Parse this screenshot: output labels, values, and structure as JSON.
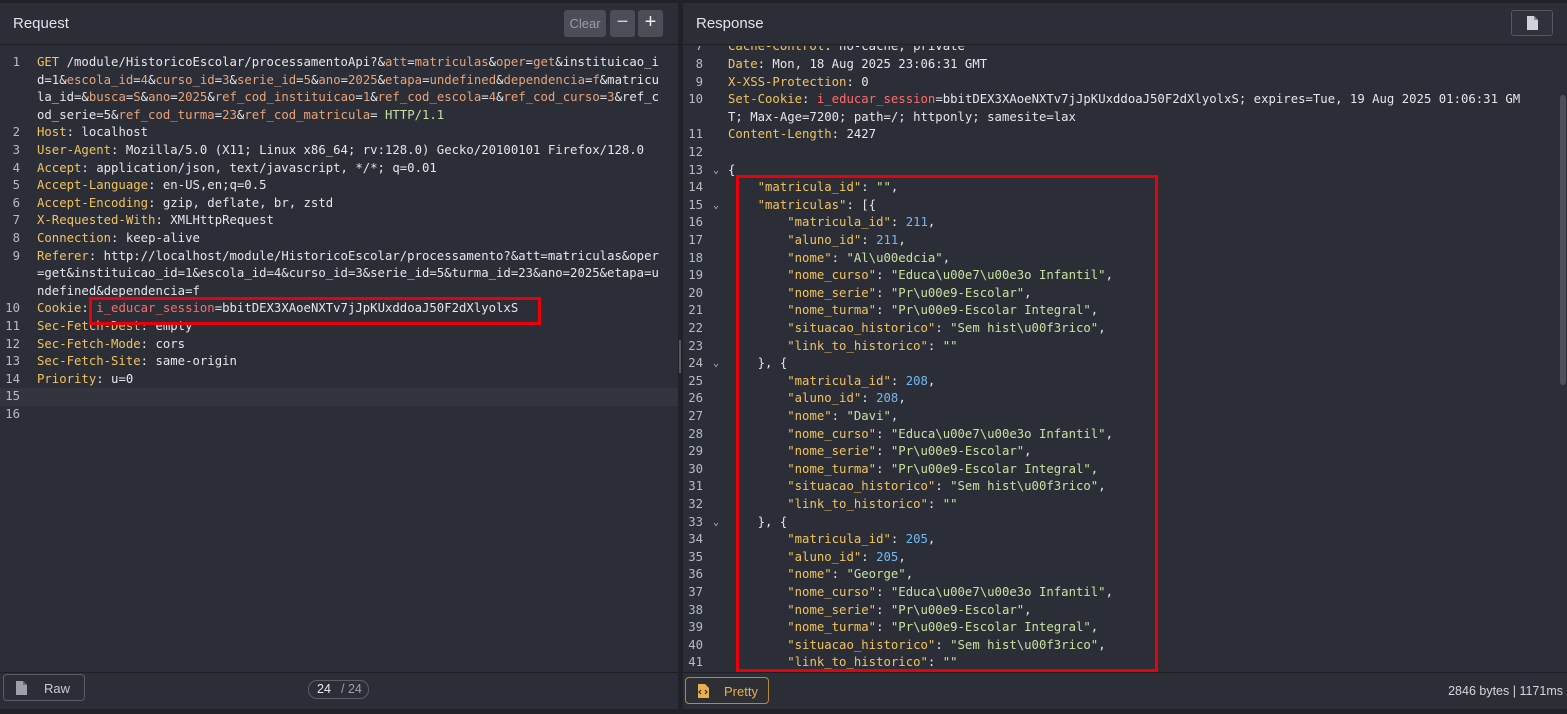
{
  "request": {
    "title": "Request",
    "clear_label": "Clear",
    "minus_label": "−",
    "plus_label": "+",
    "raw_label": "Raw",
    "pager_current": "24",
    "pager_total": "/ 24",
    "lines": [
      "GET /module/HistoricoEscolar/processamentoApi?&att=matriculas&oper=get&instituicao_i",
      "d=1&escola_id=4&curso_id=3&serie_id=5&ano=2025&etapa=undefined&dependencia=f&matricu",
      "la_id=&busca=S&ano=2025&ref_cod_instituicao=1&ref_cod_escola=4&ref_cod_curso=3&ref_c",
      "od_serie=5&ref_cod_turma=23&ref_cod_matricula= HTTP/1.1",
      "Host: localhost",
      "User-Agent: Mozilla/5.0 (X11; Linux x86_64; rv:128.0) Gecko/20100101 Firefox/128.0",
      "Accept: application/json, text/javascript, */*; q=0.01",
      "Accept-Language: en-US,en;q=0.5",
      "Accept-Encoding: gzip, deflate, br, zstd",
      "X-Requested-With: XMLHttpRequest",
      "Connection: keep-alive",
      "Referer: http://localhost/module/HistoricoEscolar/processamento?&att=matriculas&oper",
      "=get&instituicao_id=1&escola_id=4&curso_id=3&serie_id=5&turma_id=23&ano=2025&etapa=u",
      "ndefined&dependencia=f",
      "Cookie: i_educar_session=bbitDEX3XAoeNXTv7jJpKUxddoaJ50F2dXlyolxS",
      "Sec-Fetch-Dest: empty",
      "Sec-Fetch-Mode: cors",
      "Sec-Fetch-Site: same-origin",
      "Priority: u=0",
      "",
      ""
    ],
    "line_numbers": [
      "1",
      "",
      "",
      "",
      "2",
      "3",
      "4",
      "5",
      "6",
      "7",
      "8",
      "9",
      "",
      "",
      "10",
      "11",
      "12",
      "13",
      "14",
      "15",
      "16"
    ]
  },
  "response": {
    "title": "Response",
    "pretty_label": "Pretty",
    "stats": "2846 bytes  |  1171ms",
    "top_partial": "Cache-Control: no-cache, private",
    "lines": [
      "Date: Mon, 18 Aug 2025 23:06:31 GMT",
      "X-XSS-Protection: 0",
      "Set-Cookie: i_educar_session=bbitDEX3XAoeNXTv7jJpKUxddoaJ50F2dXlyolxS; expires=Tue, 19 Aug 2025 01:06:31 GM",
      "T; Max-Age=7200; path=/; httponly; samesite=lax",
      "Content-Length: 2427",
      "",
      "{",
      "    \"matricula_id\": \"\",",
      "    \"matriculas\": [{",
      "        \"matricula_id\": 211,",
      "        \"aluno_id\": 211,",
      "        \"nome\": \"Al\\u00edcia\",",
      "        \"nome_curso\": \"Educa\\u00e7\\u00e3o Infantil\",",
      "        \"nome_serie\": \"Pr\\u00e9-Escolar\",",
      "        \"nome_turma\": \"Pr\\u00e9-Escolar Integral\",",
      "        \"situacao_historico\": \"Sem hist\\u00f3rico\",",
      "        \"link_to_historico\": \"\"",
      "    }, {",
      "        \"matricula_id\": 208,",
      "        \"aluno_id\": 208,",
      "        \"nome\": \"Davi\",",
      "        \"nome_curso\": \"Educa\\u00e7\\u00e3o Infantil\",",
      "        \"nome_serie\": \"Pr\\u00e9-Escolar\",",
      "        \"nome_turma\": \"Pr\\u00e9-Escolar Integral\",",
      "        \"situacao_historico\": \"Sem hist\\u00f3rico\",",
      "        \"link_to_historico\": \"\"",
      "    }, {",
      "        \"matricula_id\": 205,",
      "        \"aluno_id\": 205,",
      "        \"nome\": \"George\",",
      "        \"nome_curso\": \"Educa\\u00e7\\u00e3o Infantil\",",
      "        \"nome_serie\": \"Pr\\u00e9-Escolar\",",
      "        \"nome_turma\": \"Pr\\u00e9-Escolar Integral\",",
      "        \"situacao_historico\": \"Sem hist\\u00f3rico\",",
      "        \"link_to_historico\": \"\""
    ],
    "line_numbers": [
      "8",
      "9",
      "10",
      "",
      "11",
      "12",
      "13",
      "14",
      "15",
      "16",
      "17",
      "18",
      "19",
      "20",
      "21",
      "22",
      "23",
      "24",
      "25",
      "26",
      "27",
      "28",
      "29",
      "30",
      "31",
      "32",
      "33",
      "34",
      "35",
      "36",
      "37",
      "38",
      "39",
      "40",
      "41"
    ]
  }
}
